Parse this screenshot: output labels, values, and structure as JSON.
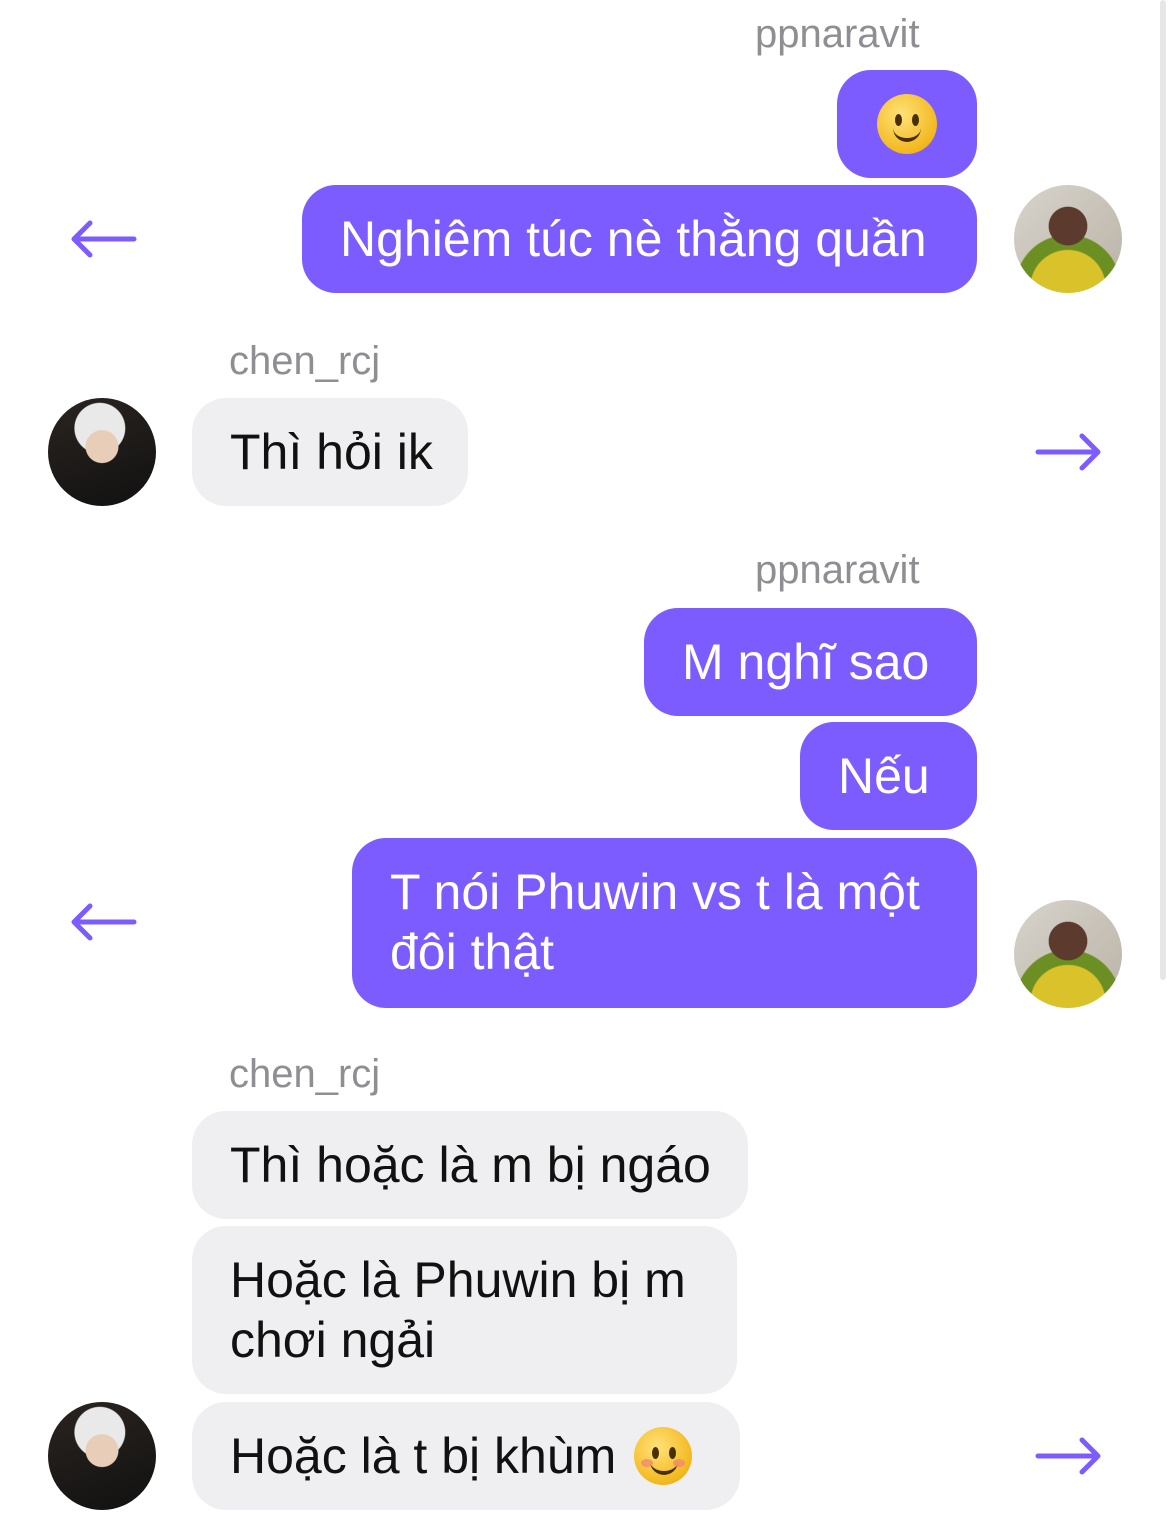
{
  "colors": {
    "outgoing_bubble": "#7c5cff",
    "incoming_bubble": "#efeff1",
    "sender_label": "#8e8e93",
    "arrow": "#7c5cff"
  },
  "messages": {
    "g1": {
      "sender": "ppnaravit",
      "emoji": "smiling-face",
      "m2": "Nghiêm túc nè thằng quần"
    },
    "g2": {
      "sender": "chen_rcj",
      "m1": "Thì hỏi ik"
    },
    "g3": {
      "sender": "ppnaravit",
      "m1": "M nghĩ sao",
      "m2": "Nếu",
      "m3": "T nói Phuwin vs t là một đôi thật"
    },
    "g4": {
      "sender": "chen_rcj",
      "m1": "Thì hoặc là m bị ngáo",
      "m2": "Hoặc là Phuwin bị m chơi ngải",
      "m3": "Hoặc là t bị khùm",
      "m3_emoji": "smiling-face-with-blush"
    }
  },
  "icons": {
    "reply_arrow_left": "arrow-left-icon",
    "reply_arrow_right": "arrow-right-icon"
  }
}
